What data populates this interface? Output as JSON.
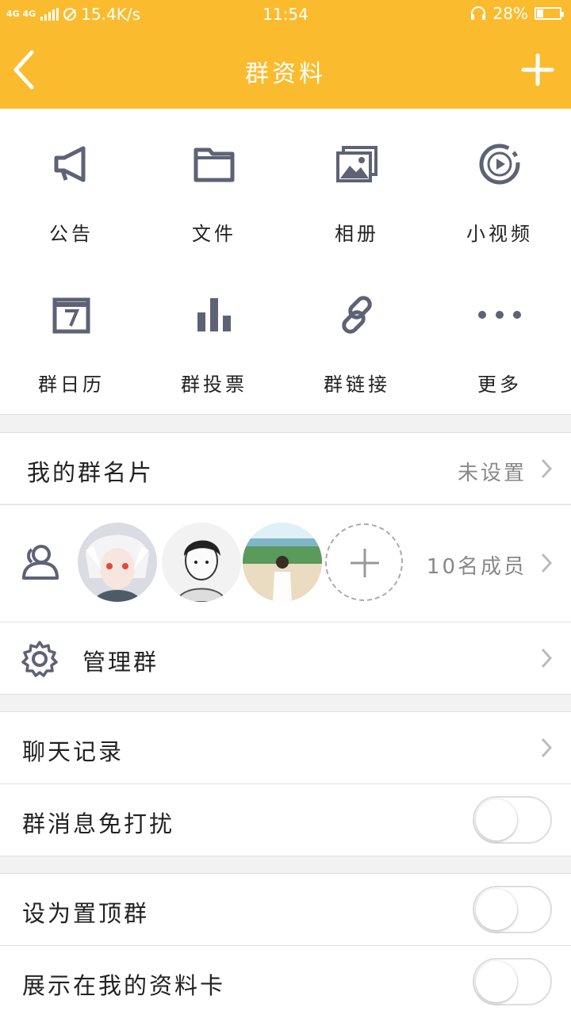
{
  "status": {
    "network": "4G 4G",
    "speed": "15.4K/s",
    "time": "11:54",
    "battery": "28%"
  },
  "header": {
    "title": "群资料"
  },
  "grid": [
    {
      "label": "公告",
      "icon": "megaphone-icon"
    },
    {
      "label": "文件",
      "icon": "folder-icon"
    },
    {
      "label": "相册",
      "icon": "album-icon"
    },
    {
      "label": "小视频",
      "icon": "video-icon"
    },
    {
      "label": "群日历",
      "icon": "calendar-icon"
    },
    {
      "label": "群投票",
      "icon": "vote-chart-icon"
    },
    {
      "label": "群链接",
      "icon": "link-icon"
    },
    {
      "label": "更多",
      "icon": "more-dots-icon"
    }
  ],
  "card": {
    "label": "我的群名片",
    "value": "未设置"
  },
  "members": {
    "count_label": "10名成员"
  },
  "manage": {
    "label": "管理群"
  },
  "chat_history": {
    "label": "聊天记录"
  },
  "mute": {
    "label": "群消息免打扰",
    "on": false
  },
  "pin": {
    "label": "设为置顶群",
    "on": false
  },
  "show_card": {
    "label": "展示在我的资料卡",
    "on": false
  },
  "colors": {
    "accent": "#fbbb2e",
    "icon": "#5e6275"
  }
}
